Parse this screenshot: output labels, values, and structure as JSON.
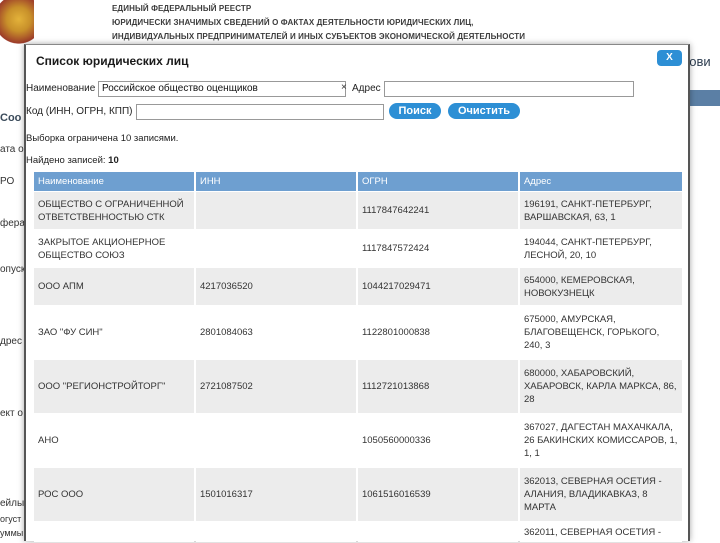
{
  "background": {
    "registry_lines": [
      "ЕДИНЫЙ ФЕДЕРАЛЬНЫЙ РЕЕСТР",
      "ЮРИДИЧЕСКИ ЗНАЧИМЫХ СВЕДЕНИЙ О ФАКТАХ ДЕЯТЕЛЬНОСТИ ЮРИДИЧЕСКИХ ЛИЦ,",
      "ИНДИВИДУАЛЬНЫХ ПРЕДПРИНИМАТЕЛЕЙ И ИНЫХ СУБЪЕКТОВ ЭКОНОМИЧЕСКОЙ ДЕЯТЕЛЬНОСТИ"
    ],
    "left_fragments": [
      "Соо",
      "ата о",
      "РО",
      "фера",
      "опуск",
      "дрес",
      "ект о",
      "ейлы",
      "огуст",
      "уммы"
    ],
    "right_title": "рови"
  },
  "modal": {
    "title": "Список юридических лиц",
    "close_label": "X",
    "name_label": "Наименование",
    "name_value": "Российское общество оценщиков",
    "clear_glyph": "×",
    "address_label": "Адрес",
    "address_value": "",
    "code_label": "Код (ИНН, ОГРН, КПП)",
    "code_value": "",
    "search_button": "Поиск",
    "clear_button": "Очистить",
    "limit_note": "Выборка ограничена 10 записями.",
    "found_label": "Найдено записей:",
    "found_count": "10"
  },
  "table": {
    "columns": [
      "Наименование",
      "ИНН",
      "ОГРН",
      "Адрес"
    ],
    "rows": [
      {
        "name": "ОБЩЕСТВО С ОГРАНИЧЕННОЙ ОТВЕТСТВЕННОСТЬЮ СТК",
        "inn": "",
        "ogrn": "1117847642241",
        "address": "196191, САНКТ-ПЕТЕРБУРГ, ВАРШАВСКАЯ, 63, 1"
      },
      {
        "name": "ЗАКРЫТОЕ АКЦИОНЕРНОЕ ОБЩЕСТВО СОЮЗ",
        "inn": "",
        "ogrn": "1117847572424",
        "address": "194044, САНКТ-ПЕТЕРБУРГ, ЛЕСНОЙ, 20, 10"
      },
      {
        "name": "ООО АПМ",
        "inn": "4217036520",
        "ogrn": "1044217029471",
        "address": "654000, КЕМЕРОВСКАЯ, НОВОКУЗНЕЦК"
      },
      {
        "name": "ЗАО \"ФУ СИН\"",
        "inn": "2801084063",
        "ogrn": "1122801000838",
        "address": "675000, АМУРСКАЯ, БЛАГОВЕЩЕНСК, ГОРЬКОГО, 240, 3"
      },
      {
        "name": "ООО \"РЕГИОНСТРОЙТОРГ\"",
        "inn": "2721087502",
        "ogrn": "1112721013868",
        "address": "680000, ХАБАРОВСКИЙ, ХАБАРОВСК, КАРЛА МАРКСА, 86, 28"
      },
      {
        "name": "АНО",
        "inn": "",
        "ogrn": "1050560000336",
        "address": "367027, ДАГЕСТАН МАХАЧКАЛА, 26 БАКИНСКИХ КОМИССАРОВ, 1, 1, 1"
      },
      {
        "name": "РОС ООО",
        "inn": "1501016317",
        "ogrn": "1061516016539",
        "address": "362013, СЕВЕРНАЯ ОСЕТИЯ - АЛАНИЯ, ВЛАДИКАВКАЗ, 8 МАРТА"
      },
      {
        "name": "",
        "inn": "",
        "ogrn": "",
        "address": "362011, СЕВЕРНАЯ ОСЕТИЯ -"
      }
    ]
  }
}
